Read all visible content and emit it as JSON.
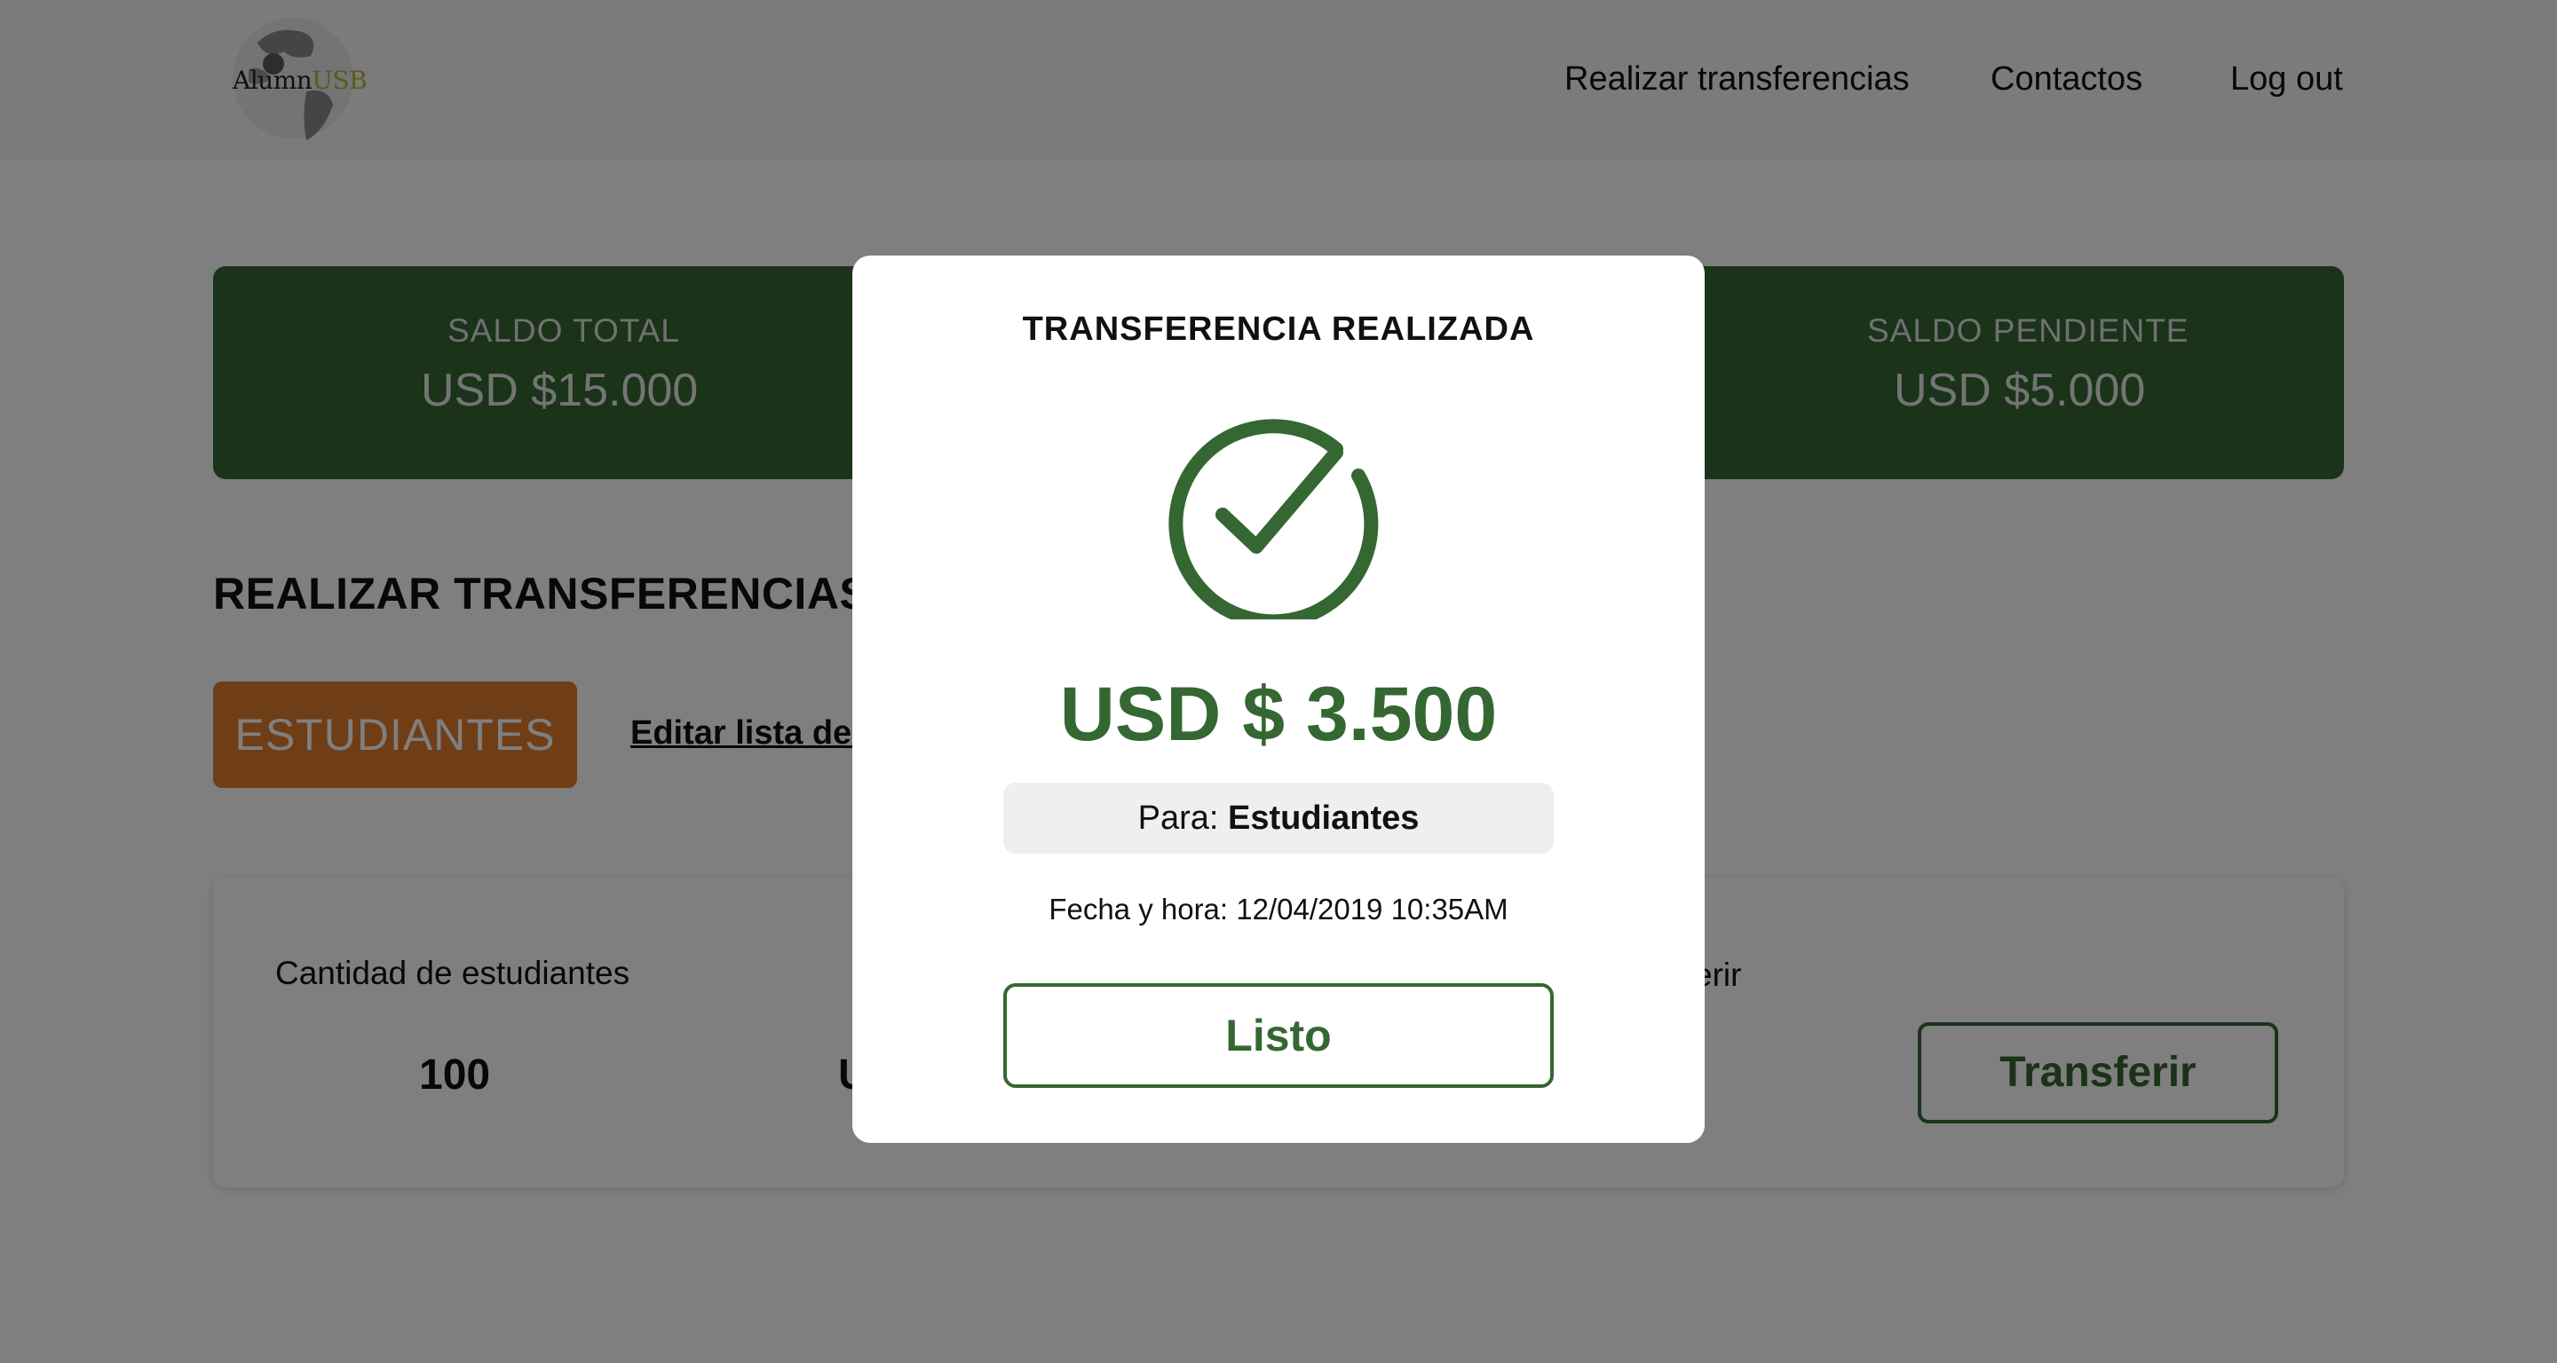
{
  "header": {
    "logo_text_prefix": "Alumn",
    "logo_text_suffix": "USB",
    "nav": [
      {
        "label": "Realizar transferencias"
      },
      {
        "label": "Contactos"
      },
      {
        "label": "Log out"
      }
    ]
  },
  "balance": {
    "total_label": "SALDO TOTAL",
    "total_value": "USD $15.000",
    "pending_label": "SALDO PENDIENTE",
    "pending_value": "USD $5.000"
  },
  "transfer_section": {
    "title": "REALIZAR TRANSFERENCIAS",
    "students_button": "ESTUDIANTES",
    "edit_link": "Editar lista de e",
    "students_count_label": "Cantidad de estudiantes",
    "students_count_value": "100",
    "amount_value_partial": "U",
    "amount_label_partial": "erir",
    "transfer_button": "Transferir"
  },
  "modal": {
    "title": "TRANSFERENCIA REALIZADA",
    "amount": "USD $ 3.500",
    "para_label": "Para:",
    "para_value": "Estudiantes",
    "date_text": "Fecha y hora: 12/04/2019 10:35AM",
    "done_button": "Listo"
  },
  "colors": {
    "brand_green": "#356733",
    "accent_orange": "#e07c2d",
    "overlay": "rgba(0,0,0,0.5)"
  },
  "icons": {
    "logo": "globe-logo-icon",
    "success": "check-circle-icon"
  }
}
